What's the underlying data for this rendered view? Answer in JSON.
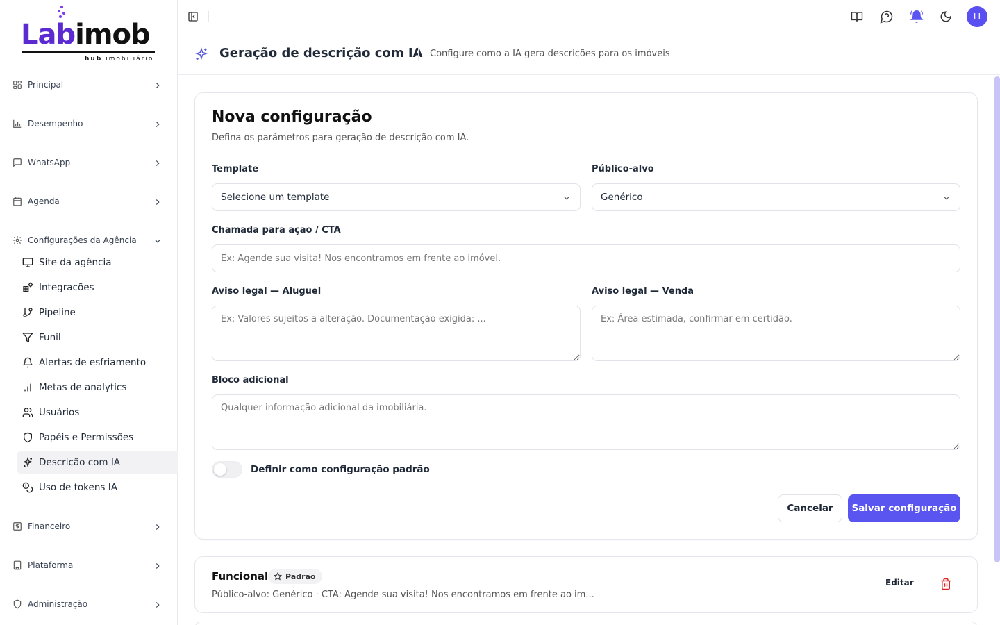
{
  "logo": {
    "part1": "Lab",
    "part2": "imob",
    "subtitle_bold": "hub",
    "subtitle": " imobiliário"
  },
  "sidebar": {
    "groups": [
      {
        "label": "Principal",
        "icon": "grid-icon"
      },
      {
        "label": "Desempenho",
        "icon": "bar-chart-icon"
      },
      {
        "label": "WhatsApp",
        "icon": "chat-icon"
      },
      {
        "label": "Agenda",
        "icon": "calendar-icon"
      },
      {
        "label": "Configurações da Agência",
        "icon": "gear-icon"
      },
      {
        "label": "Financeiro",
        "icon": "dollar-icon"
      },
      {
        "label": "Plataforma",
        "icon": "building-icon"
      },
      {
        "label": "Administração",
        "icon": "shield-icon"
      }
    ],
    "sub_items": [
      {
        "label": "Site da agência",
        "icon": "monitor-icon"
      },
      {
        "label": "Integrações",
        "icon": "blocks-icon"
      },
      {
        "label": "Pipeline",
        "icon": "git-branch-icon"
      },
      {
        "label": "Funil",
        "icon": "funnel-icon"
      },
      {
        "label": "Alertas de esfriamento",
        "icon": "bell-icon"
      },
      {
        "label": "Metas de analytics",
        "icon": "bar-chart-icon"
      },
      {
        "label": "Usuários",
        "icon": "users-icon"
      },
      {
        "label": "Papéis e Permissões",
        "icon": "shield-icon"
      },
      {
        "label": "Descrição com IA",
        "icon": "sparkles-icon",
        "active": true
      },
      {
        "label": "Uso de tokens IA",
        "icon": "coins-icon"
      }
    ]
  },
  "topbar": {
    "avatar_initials": "LI"
  },
  "page_header": {
    "title": "Geração de descrição com IA",
    "subtitle": "Configure como a IA gera descrições para os imóveis"
  },
  "form": {
    "title": "Nova configuração",
    "description": "Defina os parâmetros para geração de descrição com IA.",
    "template_label": "Template",
    "template_value": "Selecione um template",
    "audience_label": "Público-alvo",
    "audience_value": "Genérico",
    "cta_label": "Chamada para ação / CTA",
    "cta_placeholder": "Ex: Agende sua visita! Nos encontramos em frente ao imóvel.",
    "legal_rent_label": "Aviso legal — Aluguel",
    "legal_rent_placeholder": "Ex: Valores sujeitos a alteração. Documentação exigida: ...",
    "legal_sale_label": "Aviso legal — Venda",
    "legal_sale_placeholder": "Ex: Área estimada, confirmar em certidão.",
    "extra_label": "Bloco adicional",
    "extra_placeholder": "Qualquer informação adicional da imobiliária.",
    "default_switch_label": "Definir como configuração padrão",
    "cancel_label": "Cancelar",
    "save_label": "Salvar configuração"
  },
  "configs": [
    {
      "name": "Funcional",
      "badge": "Padrão",
      "meta": "Público-alvo: Genérico · CTA: Agende sua visita! Nos encontramos em frente ao im...",
      "edit_label": "Editar"
    }
  ],
  "colors": {
    "accent": "#5a55f0",
    "brand": "#5b2bd1",
    "danger": "#dc2626"
  }
}
